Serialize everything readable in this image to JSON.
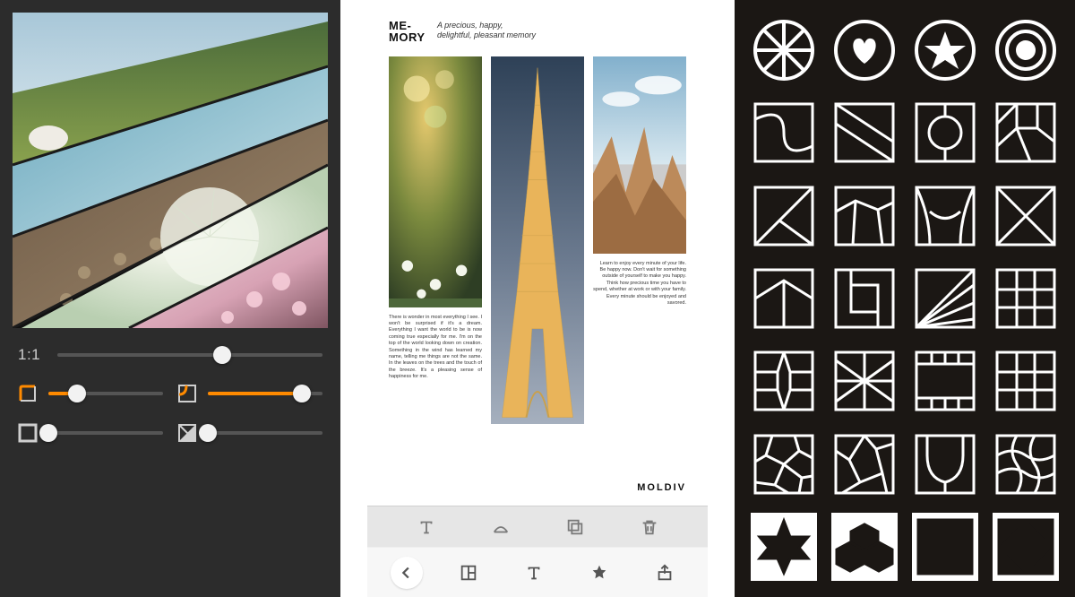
{
  "panel1": {
    "aspect_label": "1:1",
    "sliders": {
      "ratio": {
        "value": 0.62,
        "accent": true
      },
      "corner_outer": {
        "value": 0.25,
        "accent": true
      },
      "corner_inner": {
        "value": 0.82,
        "accent": true
      },
      "border": {
        "value": 0.0,
        "accent": false
      },
      "shadow": {
        "value": 0.0,
        "accent": false
      }
    },
    "icons": {
      "corner_outer": "rounded-corner-outer-icon",
      "corner_inner": "rounded-corner-inner-icon",
      "border": "border-icon",
      "shadow": "shadow-icon"
    }
  },
  "panel2": {
    "header_title": "ME-\nMORY",
    "header_subtitle": "A precious, happy,\ndelightful, pleasant memory",
    "footer_brand": "MOLDIV",
    "col1_text": "There is wonder in most everything I see. I won't be surprised if it's a dream. Everything I want the world to be is now coming true especially for me. I'm on the top of the world looking down on creation. Something in the wind has learned my name, telling me things are not the same. In the leaves on the trees and the touch of the breeze. It's a pleasing sense of happiness for me.",
    "col3_text": "Learn to enjoy every minute of your life. Be happy now. Don't wait for something outside of yourself to make you happy. Think how precious time you have to spend, whether at work or with your family. Every minute should be enjoyed and savored.",
    "toolbar_top": [
      {
        "name": "text-tool-button",
        "icon": "text-icon"
      },
      {
        "name": "resize-tool-button",
        "icon": "arc-resize-icon"
      },
      {
        "name": "duplicate-tool-button",
        "icon": "duplicate-icon"
      },
      {
        "name": "delete-tool-button",
        "icon": "trash-icon"
      }
    ],
    "toolbar_bottom": [
      {
        "name": "back-button",
        "icon": "chevron-left-icon"
      },
      {
        "name": "layout-button",
        "icon": "layout-grid-icon"
      },
      {
        "name": "text-button",
        "icon": "text-icon"
      },
      {
        "name": "favorite-button",
        "icon": "star-icon"
      },
      {
        "name": "share-button",
        "icon": "share-icon"
      }
    ]
  },
  "panel3": {
    "layouts": [
      {
        "name": "shape-circle-spoke",
        "type": "shape",
        "row": 0
      },
      {
        "name": "shape-heart",
        "type": "shape",
        "row": 0
      },
      {
        "name": "shape-star",
        "type": "shape",
        "row": 0
      },
      {
        "name": "shape-ring-dot",
        "type": "shape",
        "row": 0
      },
      {
        "name": "layout-s-curve",
        "type": "frame"
      },
      {
        "name": "layout-diag-slice",
        "type": "frame"
      },
      {
        "name": "layout-center-oval",
        "type": "frame"
      },
      {
        "name": "layout-mosaic-5",
        "type": "frame"
      },
      {
        "name": "layout-tri-corner",
        "type": "frame"
      },
      {
        "name": "layout-poly-5",
        "type": "frame"
      },
      {
        "name": "layout-drapes",
        "type": "frame"
      },
      {
        "name": "layout-envelope",
        "type": "frame"
      },
      {
        "name": "layout-roof-split",
        "type": "frame"
      },
      {
        "name": "layout-square-in",
        "type": "frame"
      },
      {
        "name": "layout-fan",
        "type": "frame"
      },
      {
        "name": "layout-cross",
        "type": "frame"
      },
      {
        "name": "layout-star-burst",
        "type": "frame"
      },
      {
        "name": "layout-radiate",
        "type": "frame"
      },
      {
        "name": "layout-film-strip",
        "type": "frame"
      },
      {
        "name": "layout-nine-grid",
        "type": "frame"
      },
      {
        "name": "layout-voronoi",
        "type": "frame"
      },
      {
        "name": "layout-aperture",
        "type": "frame"
      },
      {
        "name": "layout-shield",
        "type": "frame"
      },
      {
        "name": "layout-wave-grid",
        "type": "frame"
      },
      {
        "name": "layout-star-fill",
        "type": "shape-inverted"
      },
      {
        "name": "layout-hex-fill",
        "type": "shape-inverted"
      },
      {
        "name": "layout-brick-6",
        "type": "frame-inverted"
      },
      {
        "name": "layout-windmill",
        "type": "frame-inverted"
      }
    ]
  }
}
